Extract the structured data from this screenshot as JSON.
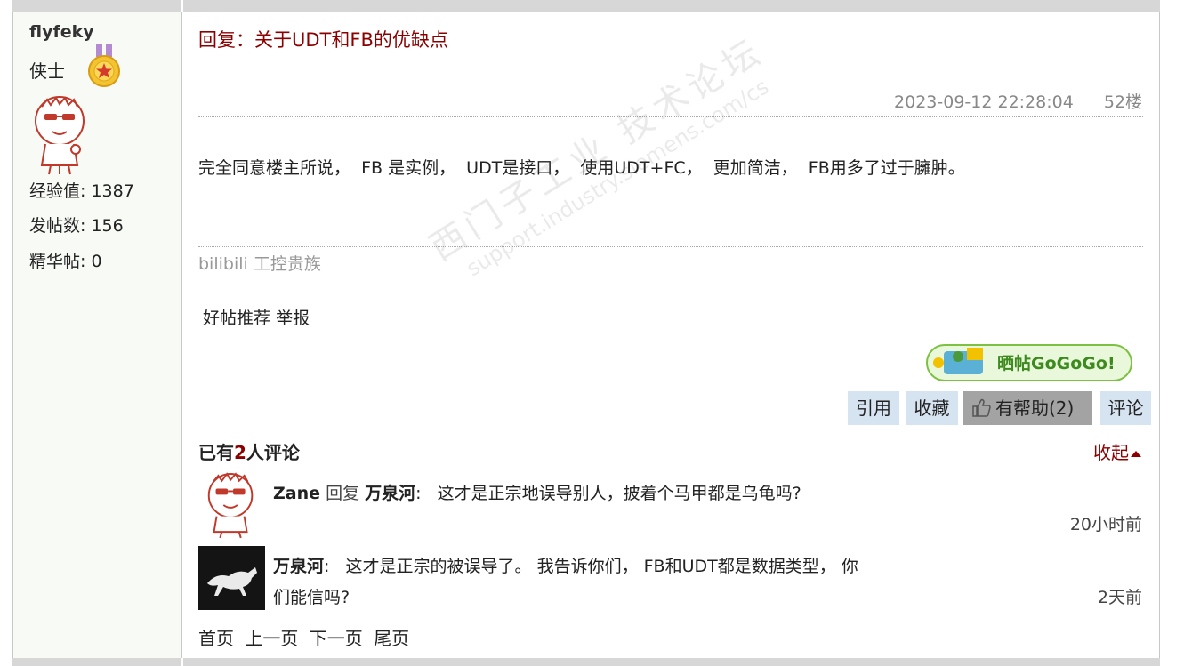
{
  "sidebar": {
    "username": "flyfeky",
    "rank": "侠士",
    "stats": [
      {
        "label": "经验值: 1387"
      },
      {
        "label": "发帖数: 156"
      },
      {
        "label": "精华帖: 0"
      }
    ]
  },
  "post": {
    "title": "回复：关于UDT和FB的优缺点",
    "datetime": "2023-09-12 22:28:04",
    "floor": "52楼",
    "content": "完全同意楼主所说，  FB 是实例，  UDT是接口，  使用UDT+FC，  更加简洁，  FB用多了过于臃肿。",
    "signature": "bilibili 工控贵族",
    "recommend": "好帖推荐",
    "report": "举报",
    "share_label": "晒帖GoGoGo!",
    "buttons": {
      "quote": "引用",
      "favorite": "收藏",
      "helpful": "有帮助(2)",
      "comment": "评论"
    }
  },
  "comments": {
    "header_prefix": "已有",
    "count": "2",
    "header_suffix": "人评论",
    "collapse": "收起",
    "items": [
      {
        "author": "Zane",
        "reply_word": "回复",
        "reply_to": "万泉河",
        "text": "这才是正宗地误导别人，披着个马甲都是乌龟吗?",
        "time": "20小时前"
      },
      {
        "author": "万泉河",
        "text_line1": "这才是正宗的被误导了。 我告诉你们，  FB和UDT都是数据类型，  你",
        "text_line2": "们能信吗?",
        "time": "2天前"
      }
    ]
  },
  "pager": {
    "first": "首页",
    "prev": "上一页",
    "next": "下一页",
    "last": "尾页"
  },
  "watermark": {
    "line1": "西门子工业 技术论坛",
    "line2": "support.industry.siemens.com/cs"
  }
}
